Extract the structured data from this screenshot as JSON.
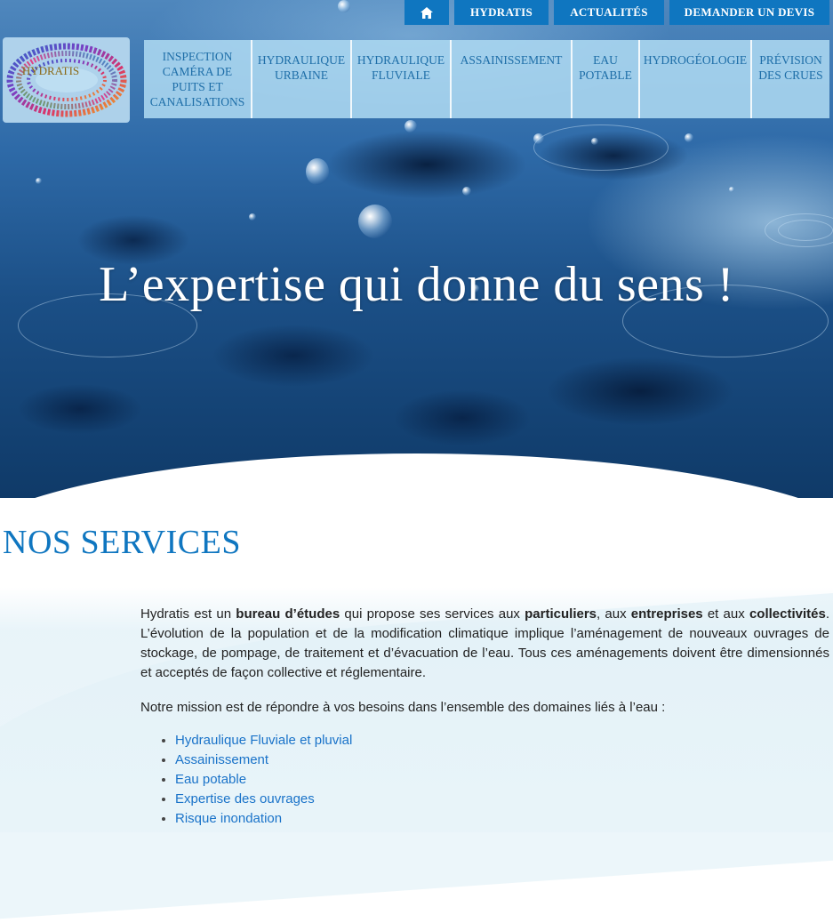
{
  "topbar": {
    "home_icon": "home-icon",
    "items": [
      "HYDRATIS",
      "ACTUALITÉS",
      "DEMANDER UN DEVIS"
    ]
  },
  "logo": {
    "text": "HYDRATIS"
  },
  "nav": {
    "items": [
      "INSPECTION CAMÉRA DE PUITS ET CANALISATIONS",
      "HYDRAULIQUE URBAINE",
      "HYDRAULIQUE FLUVIALE",
      "ASSAINISSEMENT",
      "EAU POTABLE",
      "HYDROGÉOLOGIE",
      "PRÉVISION DES CRUES"
    ]
  },
  "hero": {
    "title": "L’expertise qui donne du sens !"
  },
  "services": {
    "title": "NOS SERVICES",
    "intro": {
      "p1": "Hydratis est un ",
      "b1": "bureau d’études",
      "p2": " qui propose ses services aux ",
      "b2": "particuliers",
      "p3": ", aux ",
      "b3": "entreprises",
      "p4": " et aux ",
      "b4": "collectivités",
      "p5": ". L’évolution de la population et de la modification climatique implique l’aménagement de nouveaux ouvrages de stockage, de pompage, de traitement et d’évacuation de l’eau. Tous ces aménagements doivent être dimensionnés et acceptés de façon collective et réglementaire."
    },
    "mission": "Notre mission est de répondre à vos besoins dans l’ensemble des domaines liés à l’eau :",
    "list": [
      "Hydraulique Fluviale et pluvial",
      "Assainissement",
      "Eau potable",
      "Expertise des ouvrages",
      "Risque inondation"
    ]
  },
  "colors": {
    "brand_blue": "#0f76c0",
    "nav_text": "#1e6ea8",
    "link": "#1a73c9"
  }
}
